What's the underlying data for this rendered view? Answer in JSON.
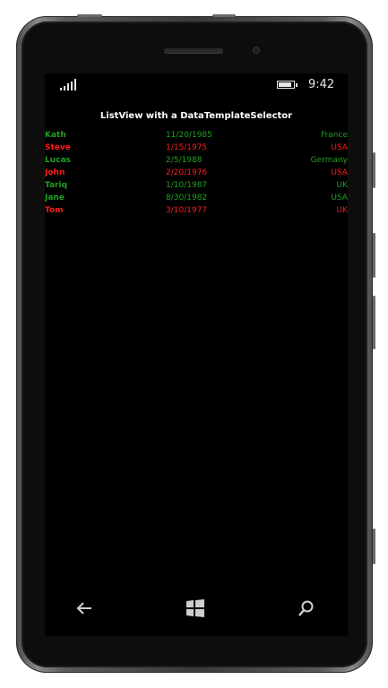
{
  "status_bar": {
    "time": "9:42",
    "signal_icon": "signal-bars-icon",
    "battery_icon": "battery-icon"
  },
  "page": {
    "title": "ListView with a DataTemplateSelector"
  },
  "colors": {
    "valid": "#1fa21f",
    "invalid": "#ff1a1a",
    "background": "#000000"
  },
  "people": [
    {
      "name": "Kath",
      "date": "11/20/1985",
      "country": "France",
      "status": "valid"
    },
    {
      "name": "Steve",
      "date": "1/15/1975",
      "country": "USA",
      "status": "invalid"
    },
    {
      "name": "Lucas",
      "date": "2/5/1988",
      "country": "Germany",
      "status": "valid"
    },
    {
      "name": "John",
      "date": "2/20/1976",
      "country": "USA",
      "status": "invalid"
    },
    {
      "name": "Tariq",
      "date": "1/10/1987",
      "country": "UK",
      "status": "valid"
    },
    {
      "name": "Jane",
      "date": "8/30/1982",
      "country": "USA",
      "status": "valid"
    },
    {
      "name": "Tom",
      "date": "3/10/1977",
      "country": "UK",
      "status": "invalid"
    }
  ],
  "nav_bar": {
    "back_icon": "back-arrow-icon",
    "start_icon": "windows-logo-icon",
    "search_icon": "search-icon"
  }
}
